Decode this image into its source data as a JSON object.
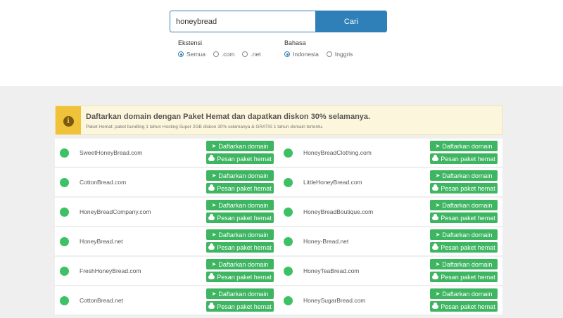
{
  "search": {
    "value": "honeybread",
    "button_label": "Cari"
  },
  "filters": {
    "extension": {
      "label": "Ekstensi",
      "options": [
        "Semua",
        ".com",
        ".net"
      ],
      "selected": "Semua"
    },
    "language": {
      "label": "Bahasa",
      "options": [
        "Indonesia",
        "Inggris"
      ],
      "selected": "Indonesia"
    }
  },
  "promo": {
    "title": "Daftarkan domain dengan Paket Hemat dan dapatkan diskon 30% selamanya.",
    "subtitle": "Paket Hemat: paket bundling 1 tahun Hosting Super 2GB diskon 30% selamanya & GRATIS 1 tahun domain tertentu.",
    "icon": "info-icon"
  },
  "actions": {
    "register_label": "Daftarkan domain",
    "bundle_label": "Pesan paket hemat",
    "register_icon": "location-arrow-icon",
    "bundle_icon": "cloud-icon"
  },
  "colors": {
    "primary": "#2f80b8",
    "available": "#3ec165",
    "action_button": "#3db561",
    "promo_accent": "#f0c23a"
  },
  "results": {
    "left": [
      {
        "domain": "SweetHoneyBread.com",
        "status": "available"
      },
      {
        "domain": "CottonBread.com",
        "status": "available"
      },
      {
        "domain": "HoneyBreadCompany.com",
        "status": "available"
      },
      {
        "domain": "HoneyBread.net",
        "status": "available"
      },
      {
        "domain": "FreshHoneyBread.com",
        "status": "available"
      },
      {
        "domain": "CottonBread.net",
        "status": "available"
      }
    ],
    "right": [
      {
        "domain": "HoneyBreadClothing.com",
        "status": "available"
      },
      {
        "domain": "LittleHoneyBread.com",
        "status": "available"
      },
      {
        "domain": "HoneyBreadBoutique.com",
        "status": "available"
      },
      {
        "domain": "Honey-Bread.net",
        "status": "available"
      },
      {
        "domain": "HoneyTeaBread.com",
        "status": "available"
      },
      {
        "domain": "HoneySugarBread.com",
        "status": "available"
      }
    ]
  }
}
